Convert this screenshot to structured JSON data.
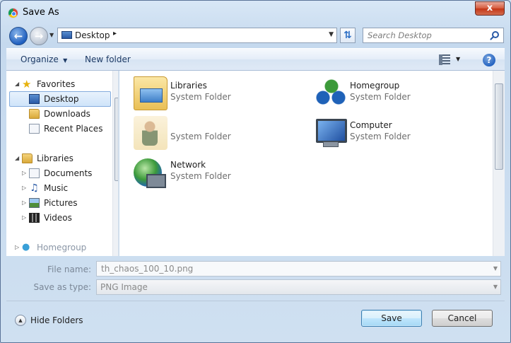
{
  "window": {
    "title": "Save As",
    "close_label": "x"
  },
  "address": {
    "location": "Desktop",
    "back_icon": "back-arrow-icon",
    "forward_icon": "forward-arrow-icon"
  },
  "search": {
    "placeholder": "Search Desktop"
  },
  "toolbar": {
    "organize_label": "Organize",
    "new_folder_label": "New folder",
    "help_label": "?"
  },
  "sidebar": {
    "favorites_label": "Favorites",
    "favorites": [
      {
        "label": "Desktop",
        "icon": "desktop-icon",
        "selected": true
      },
      {
        "label": "Downloads",
        "icon": "folder-icon"
      },
      {
        "label": "Recent Places",
        "icon": "recent-places-icon"
      }
    ],
    "libraries_label": "Libraries",
    "libraries": [
      {
        "label": "Documents",
        "icon": "documents-icon"
      },
      {
        "label": "Music",
        "icon": "music-icon"
      },
      {
        "label": "Pictures",
        "icon": "pictures-icon"
      },
      {
        "label": "Videos",
        "icon": "videos-icon"
      }
    ],
    "homegroup_label": "Homegroup"
  },
  "content": {
    "items": [
      {
        "name": "Libraries",
        "type": "System Folder",
        "icon": "libraries-folder-icon"
      },
      {
        "name": "Homegroup",
        "type": "System Folder",
        "icon": "homegroup-icon"
      },
      {
        "name": "",
        "type": "System Folder",
        "icon": "user-folder-icon"
      },
      {
        "name": "Computer",
        "type": "System Folder",
        "icon": "computer-icon"
      },
      {
        "name": "Network",
        "type": "System Folder",
        "icon": "network-icon"
      }
    ]
  },
  "form": {
    "file_name_label": "File name:",
    "file_name_value": "th_chaos_100_10.png",
    "save_as_type_label": "Save as type:",
    "save_as_type_value": "PNG Image"
  },
  "footer": {
    "hide_folders_label": "Hide Folders",
    "save_label": "Save",
    "cancel_label": "Cancel"
  }
}
